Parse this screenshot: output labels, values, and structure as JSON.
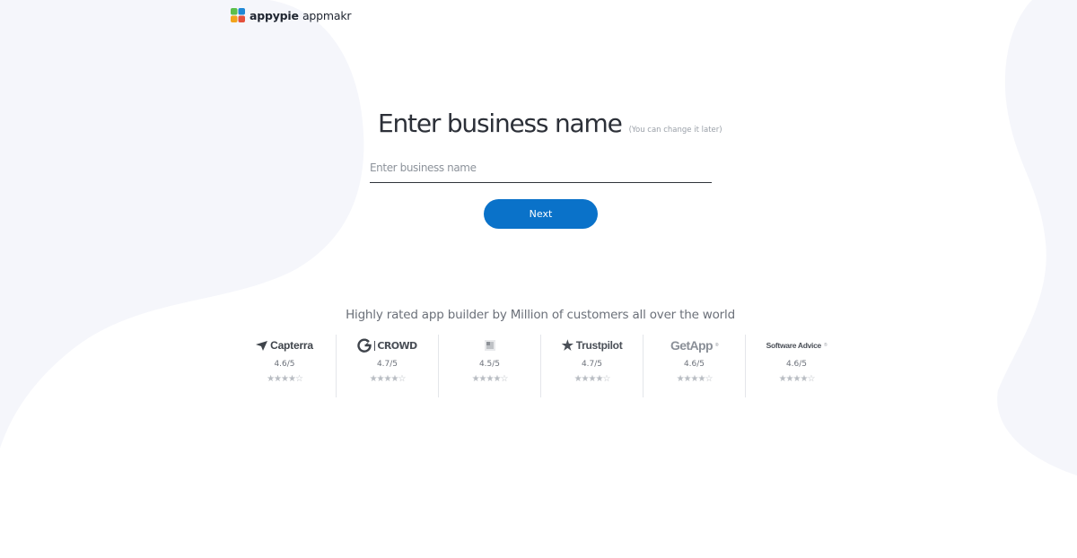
{
  "brand": {
    "name_bold": "appypie",
    "name_light": "appmakr"
  },
  "form": {
    "title": "Enter business name",
    "hint": "(You can change it later)",
    "input_placeholder": "Enter business name",
    "input_value": "",
    "next_label": "Next"
  },
  "tagline": "Highly rated app builder by Million of customers all over the world",
  "ratings": [
    {
      "brand": "Capterra",
      "score": "4.6/5",
      "stars": "★★★★☆",
      "icon": "capterra-arrow-icon"
    },
    {
      "brand": "CROWD",
      "score": "4.7/5",
      "stars": "★★★★☆",
      "icon": "g2-icon"
    },
    {
      "brand": "",
      "score": "4.5/5",
      "stars": "★★★★☆",
      "icon": "square-logo-icon"
    },
    {
      "brand": "Trustpilot",
      "score": "4.7/5",
      "stars": "★★★★☆",
      "icon": "star-icon"
    },
    {
      "brand": "GetApp",
      "score": "4.6/5",
      "stars": "★★★★☆",
      "icon": ""
    },
    {
      "brand": "Software Advice",
      "score": "4.6/5",
      "stars": "★★★★☆",
      "icon": ""
    }
  ],
  "colors": {
    "primary": "#0a72c9",
    "background_shape": "#f5f6fb"
  }
}
